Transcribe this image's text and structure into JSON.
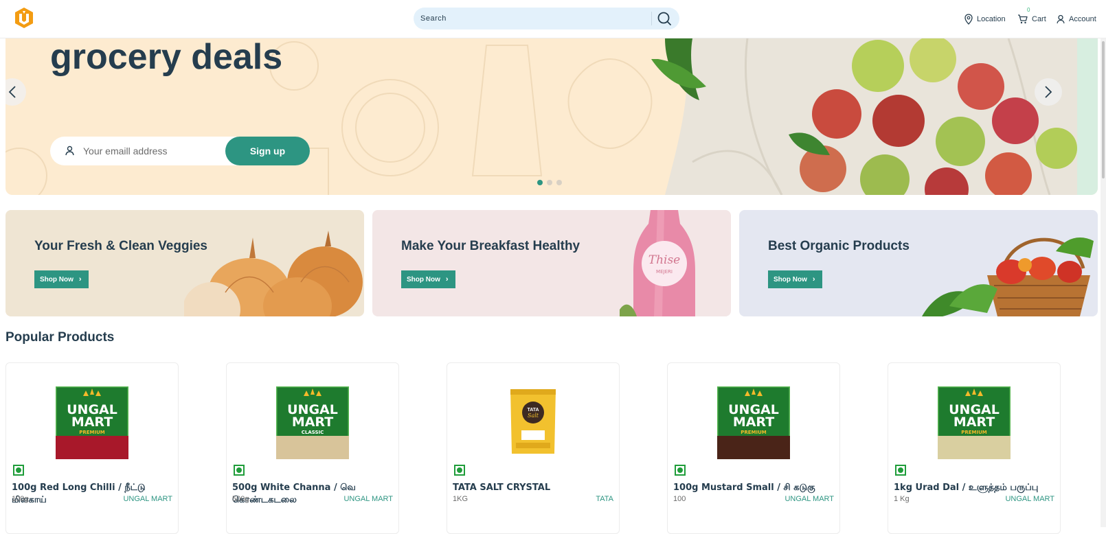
{
  "header": {
    "search_placeholder": "Search",
    "nav": {
      "location": "Location",
      "cart": "Cart",
      "cart_count": "0",
      "account": "Account"
    }
  },
  "hero": {
    "title": "grocery deals",
    "email_placeholder": "Your emaill address",
    "signup_label": "Sign up",
    "slides": 3,
    "active_slide": 1
  },
  "banners": [
    {
      "title": "Your Fresh & Clean Veggies",
      "button": "Shop Now",
      "bg": "#efe5d3"
    },
    {
      "title": "Make Your Breakfast Healthy",
      "button": "Shop Now",
      "bg": "#f3e6e6"
    },
    {
      "title": "Best Organic Products",
      "button": "Shop Now",
      "bg": "#e4e7f1"
    }
  ],
  "popular_products": {
    "title": "Popular Products",
    "items": [
      {
        "name": "100g Red Long Chilli / நீட்டு மிளகாய்",
        "qty": "100g",
        "brand": "UNGAL MART",
        "pack": "red-chilli",
        "tier": "PREMIUM"
      },
      {
        "name": "500g White Channa / வெ கொண்டகடலை",
        "qty": "500g",
        "brand": "UNGAL MART",
        "pack": "white-channa",
        "tier": "CLASSIC"
      },
      {
        "name": "TATA SALT CRYSTAL",
        "qty": "1KG",
        "brand": "TATA",
        "pack": "tata-salt",
        "tier": ""
      },
      {
        "name": "100g Mustard Small / சி கடுகு",
        "qty": "100",
        "brand": "UNGAL MART",
        "pack": "mustard",
        "tier": "PREMIUM"
      },
      {
        "name": "1kg Urad Dal / உளுத்தம் பருப்பு",
        "qty": "1 Kg",
        "brand": "UNGAL MART",
        "pack": "urad-dal",
        "tier": "PREMIUM"
      }
    ]
  },
  "brand_pack_text": {
    "line1": "UNGAL",
    "line2": "MART"
  },
  "colors": {
    "accent": "#2d9582",
    "heading": "#253d4e",
    "veg": "#1f9d3a",
    "brand_green": "#1e7b2e"
  }
}
